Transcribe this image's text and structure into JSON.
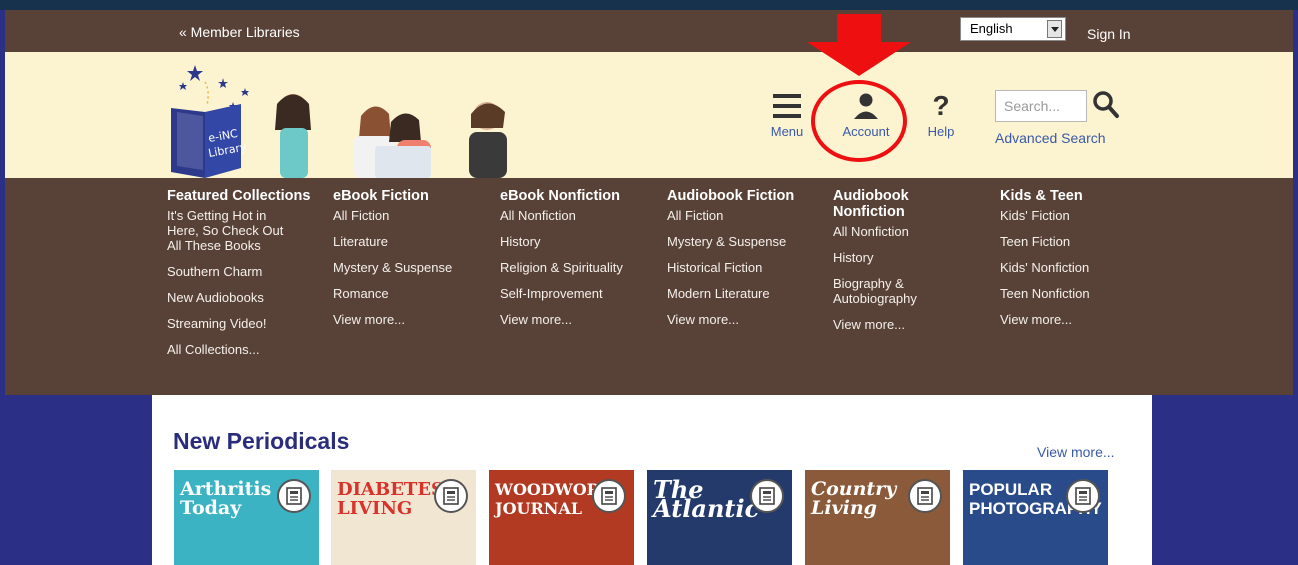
{
  "topbar": {
    "member_libraries": "« Member Libraries",
    "language": "English",
    "sign_in": "Sign In"
  },
  "header": {
    "logo_text": "e-iNC Library",
    "nav": {
      "menu": "Menu",
      "account": "Account",
      "help": "Help"
    },
    "search_placeholder": "Search...",
    "advanced_search": "Advanced Search"
  },
  "mega_menu": [
    {
      "heading": "Featured Collections",
      "items": [
        "It's Getting Hot in Here, So Check Out All These Books",
        "Southern Charm",
        "New Audiobooks",
        "Streaming Video!",
        "All Collections..."
      ]
    },
    {
      "heading": "eBook Fiction",
      "items": [
        "All Fiction",
        "Literature",
        "Mystery & Suspense",
        "Romance",
        "View more..."
      ]
    },
    {
      "heading": "eBook Nonfiction",
      "items": [
        "All Nonfiction",
        "History",
        "Religion & Spirituality",
        "Self-Improvement",
        "View more..."
      ]
    },
    {
      "heading": "Audiobook Fiction",
      "items": [
        "All Fiction",
        "Mystery & Suspense",
        "Historical Fiction",
        "Modern Literature",
        "View more..."
      ]
    },
    {
      "heading": "Audiobook Nonfiction",
      "items": [
        "All Nonfiction",
        "History",
        "Biography & Autobiography",
        "View more..."
      ]
    },
    {
      "heading": "Kids & Teen",
      "items": [
        "Kids' Fiction",
        "Teen Fiction",
        "Kids' Nonfiction",
        "Teen Nonfiction",
        "View more..."
      ]
    }
  ],
  "periodicals": {
    "title": "New Periodicals",
    "view_more": "View more...",
    "covers": [
      {
        "title": "Arthritis Today",
        "bg": "#3bb3c3",
        "fg": "#ffffff"
      },
      {
        "title": "DIABETES LIVING",
        "bg": "#f0e6d2",
        "fg": "#d9322b"
      },
      {
        "title": "WOODWORK JOURNAL",
        "bg": "#b33a22",
        "fg": "#ffffff"
      },
      {
        "title": "The Atlantic",
        "bg": "#233a6b",
        "fg": "#ffffff"
      },
      {
        "title": "Country Living",
        "bg": "#8a5a3a",
        "fg": "#ffffff"
      },
      {
        "title": "POPULAR PHOTOGRAPHY",
        "bg": "#2a4b8a",
        "fg": "#ffffff"
      }
    ]
  },
  "colors": {
    "utility_bar": "#584238",
    "header_band": "#fcf3d1",
    "page_bg": "#2b2f86",
    "link_blue": "#3a5aa8",
    "annotation_red": "#ee1010"
  }
}
